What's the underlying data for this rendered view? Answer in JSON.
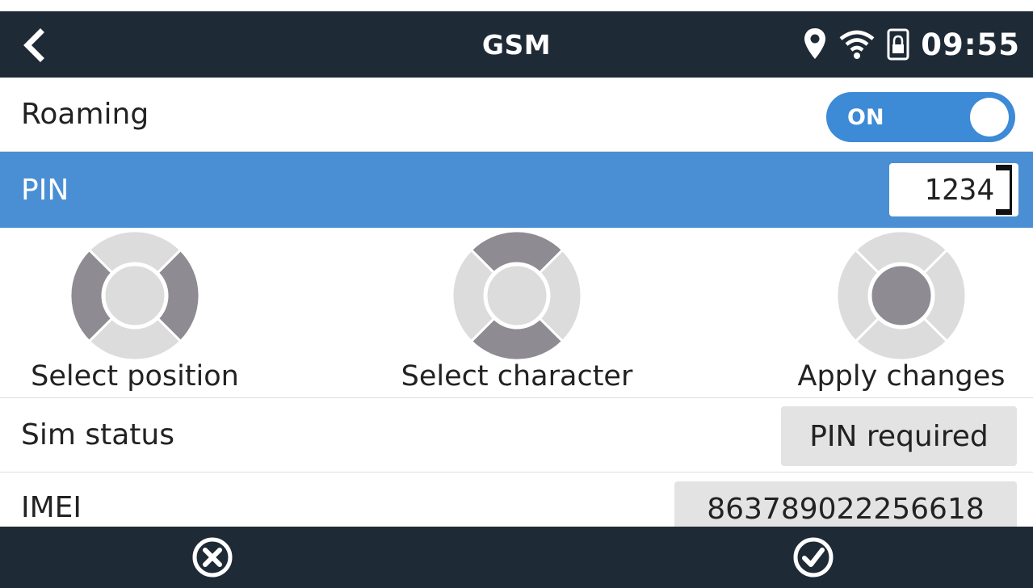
{
  "header": {
    "title": "GSM",
    "time": "09:55",
    "icons": [
      "back-arrow-icon",
      "location-pin-icon",
      "wifi-icon",
      "lock-icon"
    ]
  },
  "rows": {
    "roaming": {
      "label": "Roaming",
      "toggle_text": "ON",
      "toggle_on": true
    },
    "pin": {
      "label": "PIN",
      "value": "1234"
    },
    "sim_status": {
      "label": "Sim status",
      "value": "PIN required"
    },
    "imei": {
      "label": "IMEI",
      "value": "863789022256618"
    }
  },
  "keypad_hints": [
    {
      "label": "Select position",
      "icon": "left-right-keys-icon"
    },
    {
      "label": "Select character",
      "icon": "up-down-keys-icon"
    },
    {
      "label": "Apply changes",
      "icon": "center-key-icon"
    }
  ],
  "footer": {
    "cancel_icon": "cancel-icon",
    "confirm_icon": "confirm-icon"
  },
  "colors": {
    "header_bg": "#1f2a37",
    "accent": "#3d8ad6",
    "selected_row": "#4a8fd3",
    "chip_bg": "#e3e3e3",
    "keypad_light": "#dcdcdc",
    "keypad_dark": "#8e8b93"
  }
}
